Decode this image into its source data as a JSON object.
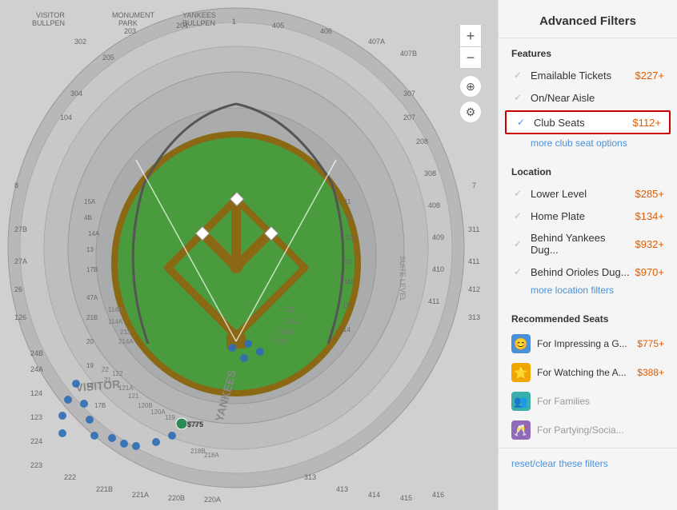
{
  "panel": {
    "title": "Advanced Filters",
    "features_label": "Features",
    "location_label": "Location",
    "recommended_label": "Recommended Seats",
    "features": [
      {
        "label": "Emailable Tickets",
        "price": "$227+",
        "checked": true,
        "dimmed": true
      },
      {
        "label": "On/Near Aisle",
        "price": "",
        "checked": true,
        "dimmed": true
      },
      {
        "label": "Club Seats",
        "price": "$112+",
        "checked": true,
        "dimmed": false,
        "highlighted": true
      }
    ],
    "more_club": "more club seat options",
    "location": [
      {
        "label": "Lower Level",
        "price": "$285+",
        "checked": true,
        "dimmed": true
      },
      {
        "label": "Home Plate",
        "price": "$134+",
        "checked": true,
        "dimmed": true
      },
      {
        "label": "Behind Yankees Dug...",
        "price": "$932+",
        "checked": true,
        "dimmed": true
      },
      {
        "label": "Behind Orioles Dug...",
        "price": "$970+",
        "checked": true,
        "dimmed": true
      }
    ],
    "more_location": "more location filters",
    "recommended": [
      {
        "label": "For Impressing a G...",
        "price": "$775+",
        "icon": "😊",
        "icon_class": "blue",
        "dimmed": false
      },
      {
        "label": "For Watching the A...",
        "price": "$388+",
        "icon": "⭐",
        "icon_class": "gold",
        "dimmed": false
      },
      {
        "label": "For Families",
        "price": "",
        "icon": "👥",
        "icon_class": "teal",
        "dimmed": true
      },
      {
        "label": "For Partying/Socia...",
        "price": "",
        "icon": "🥂",
        "icon_class": "purple",
        "dimmed": true
      }
    ],
    "reset_label": "reset/clear these filters"
  },
  "map": {
    "zoom_in": "+",
    "zoom_out": "−"
  }
}
